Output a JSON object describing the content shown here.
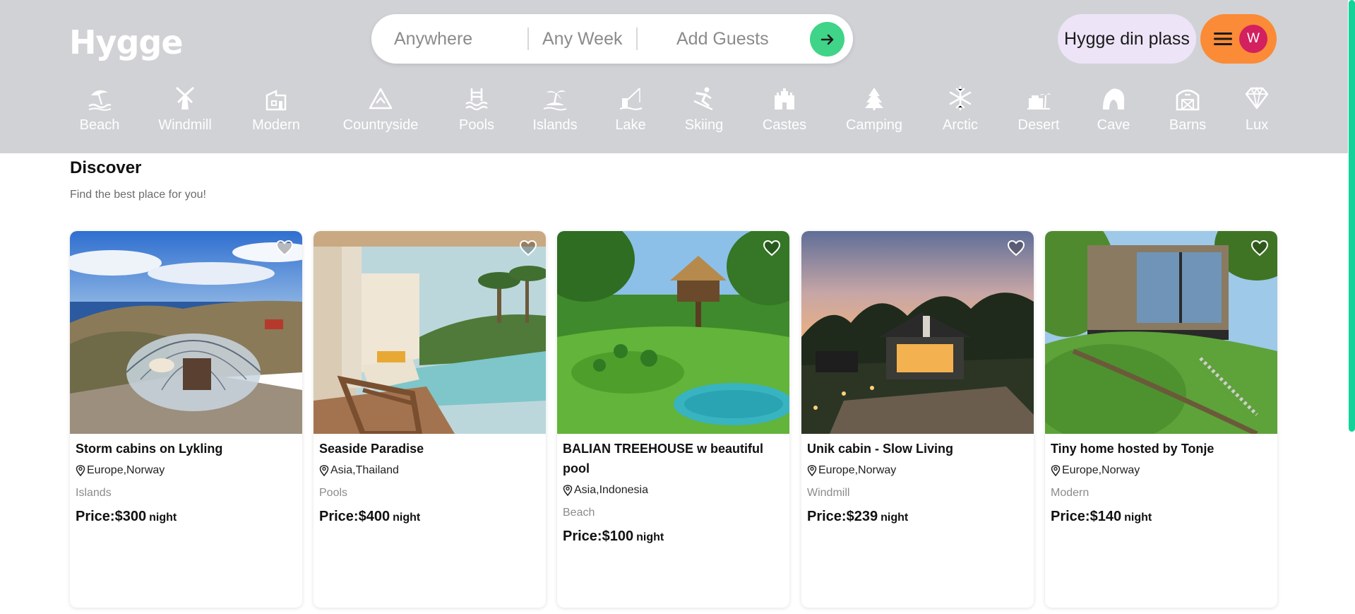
{
  "app": {
    "logo": "Hygge"
  },
  "search": {
    "where": "Anywhere",
    "when": "Any Week",
    "guests": "Add Guests"
  },
  "header": {
    "host_label": "Hygge din plass",
    "avatar_initial": "W"
  },
  "categories": [
    {
      "label": "Beach",
      "icon": "beach-icon"
    },
    {
      "label": "Windmill",
      "icon": "windmill-icon"
    },
    {
      "label": "Modern",
      "icon": "modern-house-icon"
    },
    {
      "label": "Countryside",
      "icon": "mountain-icon"
    },
    {
      "label": "Pools",
      "icon": "pool-icon"
    },
    {
      "label": "Islands",
      "icon": "island-icon"
    },
    {
      "label": "Lake",
      "icon": "lake-icon"
    },
    {
      "label": "Skiing",
      "icon": "skiing-icon"
    },
    {
      "label": "Castes",
      "icon": "castle-icon"
    },
    {
      "label": "Camping",
      "icon": "camping-icon"
    },
    {
      "label": "Arctic",
      "icon": "snowflake-icon"
    },
    {
      "label": "Desert",
      "icon": "desert-icon"
    },
    {
      "label": "Cave",
      "icon": "cave-icon"
    },
    {
      "label": "Barns",
      "icon": "barn-icon"
    },
    {
      "label": "Lux",
      "icon": "diamond-icon"
    }
  ],
  "discover": {
    "title": "Discover",
    "subtitle": "Find the best place for you!"
  },
  "listings": [
    {
      "title": "Storm cabins on Lykling",
      "location": "Europe,Norway",
      "category": "Islands",
      "price_label": "Price:",
      "price": "$300",
      "unit": "night"
    },
    {
      "title": "Seaside Paradise",
      "location": "Asia,Thailand",
      "category": "Pools",
      "price_label": "Price:",
      "price": "$400",
      "unit": "night"
    },
    {
      "title": "BALIAN TREEHOUSE w beautiful pool",
      "location": "Asia,Indonesia",
      "category": "Beach",
      "price_label": "Price:",
      "price": "$100",
      "unit": "night"
    },
    {
      "title": "Unik cabin - Slow Living",
      "location": "Europe,Norway",
      "category": "Windmill",
      "price_label": "Price:",
      "price": "$239",
      "unit": "night"
    },
    {
      "title": "Tiny home hosted by Tonje",
      "location": "Europe,Norway",
      "category": "Modern",
      "price_label": "Price:",
      "price": "$140",
      "unit": "night"
    }
  ],
  "colors": {
    "header_bg": "#d1d2d6",
    "search_button": "#3fd487",
    "host_button_bg": "#ede4f8",
    "user_menu_bg": "#fb8b36",
    "avatar_bg": "#d3205e",
    "scrollbar_thumb": "#14d29a"
  }
}
